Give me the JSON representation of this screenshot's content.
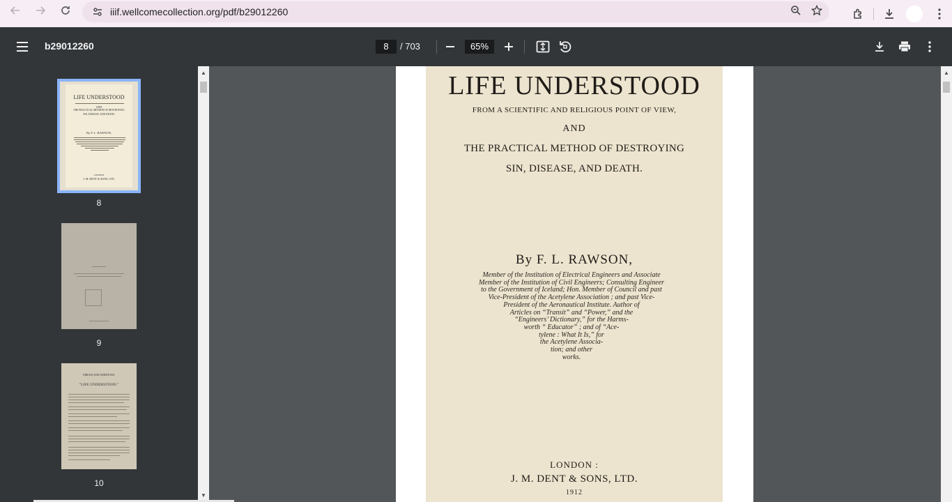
{
  "browser": {
    "url": "iiif.wellcomecollection.org/pdf/b29012260"
  },
  "toolbar": {
    "title": "b29012260",
    "current_page": "8",
    "total_pages": "/ 703",
    "zoom": "65%"
  },
  "sidebar": {
    "thumbnails": [
      {
        "page": "8",
        "selected": true
      },
      {
        "page": "9",
        "selected": false
      },
      {
        "page": "10",
        "selected": false
      }
    ],
    "thumb8": {
      "title": "LIFE  UNDERSTOOD",
      "and": "AND",
      "line1": "THE PRACTICAL METHOD OF DESTROYING",
      "line2": "SIN, DISEASE, AND DEATH.",
      "author": "By F. L. RAWSON,",
      "london": "LONDON",
      "publisher": "J. M. DENT & SONS, LTD."
    },
    "thumb10": {
      "heading": "ERRATA AND ADDITIONS.",
      "title": "“LIFE  UNDERSTOOD.”"
    }
  },
  "document": {
    "title": "LIFE  UNDERSTOOD",
    "subtitle": "FROM A SCIENTIFIC AND RELIGIOUS POINT OF VIEW,",
    "and": "AND",
    "line1": "THE PRACTICAL METHOD OF DESTROYING",
    "line2": "SIN, DISEASE, AND DEATH.",
    "author": "By  F.  L.  RAWSON,",
    "credentials": [
      "Member  of  the  Institution  of  Electrical  Engineers  and  Associate",
      "Member of the Institution of Civil Engineers; Consulting  Engineer",
      "to the Government of Iceland; Hon. Member of Council and past",
      "Vice-President  of  the  Acetylene  Association ;  and past  Vice-",
      "President  of  the  Aeronautical  Institute.  Author  of",
      "Articles  on  “Transit”  and  “Power,”  and  the",
      "“Engineers’ Dictionary,” for  the  Harms-",
      "worth  “ Educator” ;  and  of  “Ace-",
      "tylene :  What  It  Is,”  for",
      "the Acetylene Associa-",
      "tion; and other",
      "works."
    ],
    "london": "LONDON :",
    "publisher": "J. M. DENT & SONS, LTD.",
    "year": "1912"
  }
}
